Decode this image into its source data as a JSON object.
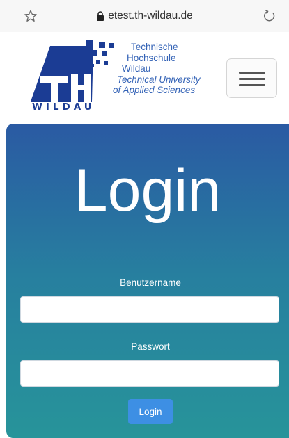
{
  "browser": {
    "url": "etest.th-wildau.de",
    "icons": {
      "bookmark": "star-outline-icon",
      "secure": "lock-icon",
      "reload": "reload-icon"
    }
  },
  "header": {
    "logo": {
      "mark_text": "TH",
      "wordmark": "WILDAU",
      "lines": [
        "Technische",
        "Hochschule",
        "Wildau",
        "Technical University",
        "of Applied Sciences"
      ]
    },
    "menu_icon": "hamburger-icon"
  },
  "login_form": {
    "title": "Login",
    "username": {
      "label": "Benutzername",
      "value": "",
      "placeholder": ""
    },
    "password": {
      "label": "Passwort",
      "value": "",
      "placeholder": ""
    },
    "submit_label": "Login"
  },
  "colors": {
    "brand_blue": "#1b3c94",
    "logo_text_blue": "#3463b6",
    "card_gradient_top": "#2a5aa3",
    "card_gradient_bottom": "#27949a",
    "button_blue": "#3d8fe4"
  }
}
